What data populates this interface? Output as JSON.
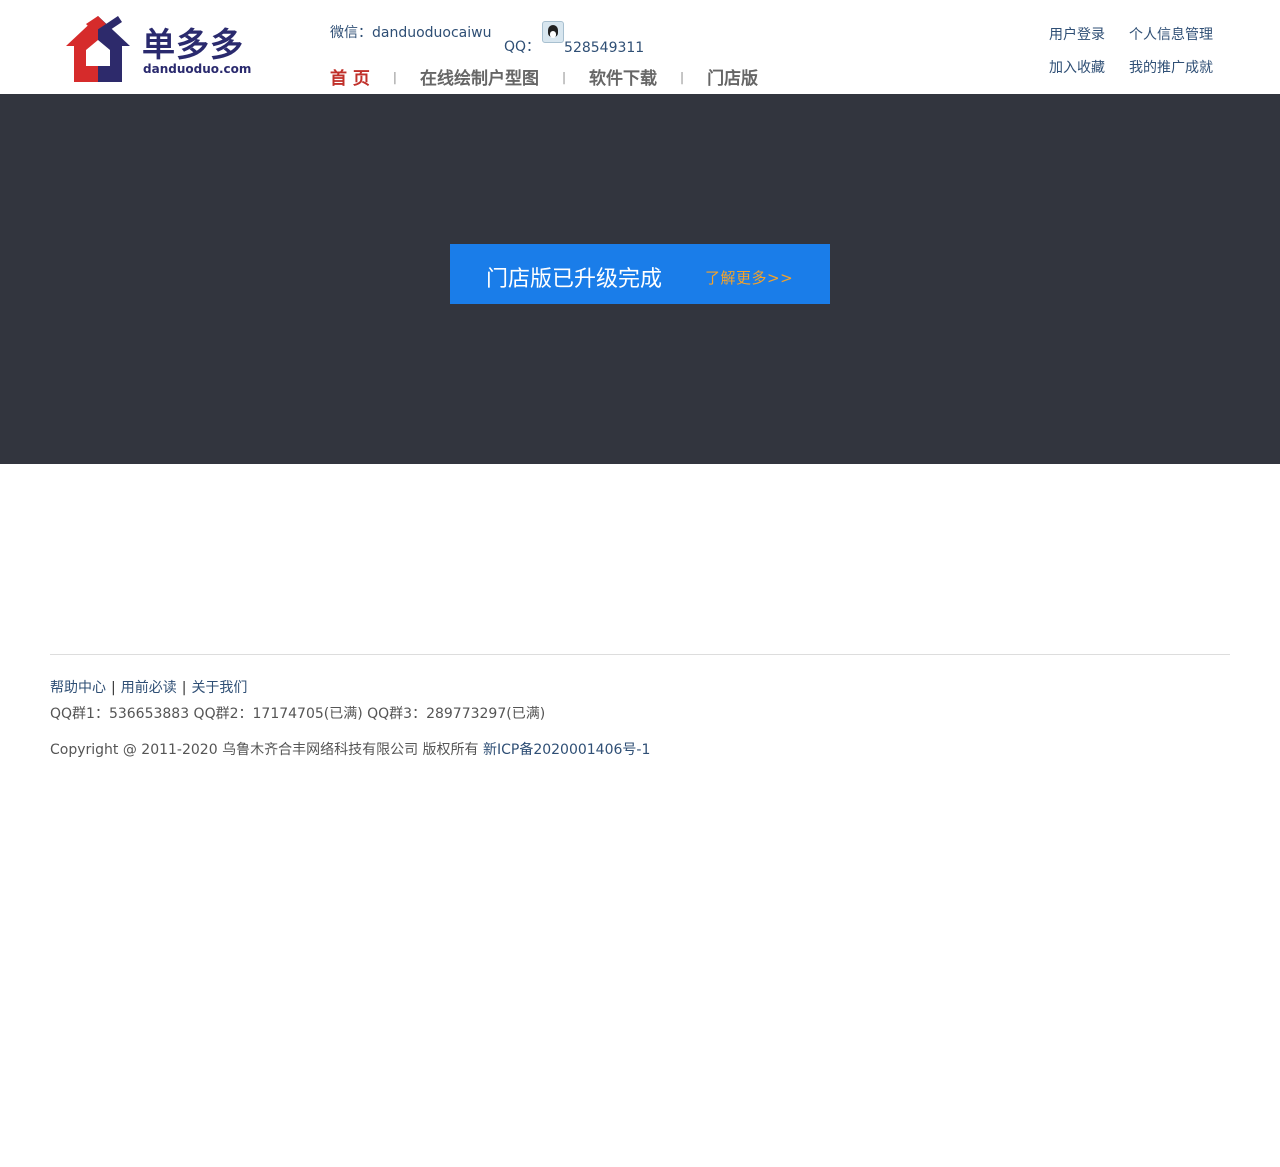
{
  "header": {
    "logo": {
      "name": "单多多",
      "domain": "danduoduo.com"
    },
    "wechat": {
      "label": "微信：",
      "value": "danduoduocaiwu"
    },
    "qq": {
      "label": "QQ：",
      "icon": "qq-penguin-icon",
      "value": "528549311"
    },
    "nav": [
      {
        "label": "首 页",
        "active": true
      },
      {
        "label": "在线绘制户型图",
        "active": false
      },
      {
        "label": "软件下载",
        "active": false
      },
      {
        "label": "门店版",
        "active": false
      }
    ],
    "nav_separator": "|",
    "user_links": [
      "用户登录",
      "个人信息管理",
      "加入收藏",
      "我的推广成就"
    ]
  },
  "banner": {
    "notice": "门店版已升级完成",
    "more": "了解更多>>",
    "colors": {
      "background": "#32353e",
      "notice_bg": "#1a7de9",
      "more_text": "#f5a32a"
    }
  },
  "footer": {
    "links": [
      "帮助中心",
      "用前必读",
      "关于我们"
    ],
    "link_separator": "|",
    "qq_groups": "QQ群1：536653883 QQ群2：17174705(已满) QQ群3：289773297(已满)",
    "copyright": "Copyright @ 2011-2020 乌鲁木齐合丰网络科技有限公司 版权所有",
    "icp": "新ICP备2020001406号-1"
  }
}
